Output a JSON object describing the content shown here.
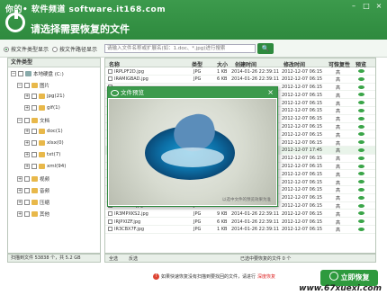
{
  "watermark_top": "你的• 软件频道 software.it168.com",
  "header": {
    "title": "请选择需要恢复的文件"
  },
  "window_buttons": [
    "–",
    "□",
    "×"
  ],
  "options": {
    "by_type": "按文件类型显示",
    "by_path": "按文件路径显示",
    "search_placeholder": "请输入文件名称或扩展名(如：1.doc、*.jpg)进行搜索",
    "search_button": "🔍"
  },
  "tree": {
    "header": "文件类型",
    "disk": "本地硬盘 (C:)",
    "items": [
      {
        "label": "图片"
      },
      {
        "label": "jpg(21)"
      },
      {
        "label": "gif(1)"
      },
      {
        "label": "文档"
      },
      {
        "label": "doc(1)"
      },
      {
        "label": "xlsx(0)"
      },
      {
        "label": "txt(7)"
      },
      {
        "label": "xml(94)"
      },
      {
        "label": "视频"
      },
      {
        "label": "音频"
      },
      {
        "label": "压缩"
      },
      {
        "label": "其他"
      }
    ]
  },
  "table": {
    "headers": [
      "名称",
      "类型",
      "大小",
      "创建时间",
      "修改时间",
      "可恢复性",
      "预览"
    ],
    "rows": [
      {
        "name": "IRPLPF2D.jpg",
        "type": "JPG",
        "size": "1 KB",
        "created": "2014-01-26 22:39:11",
        "modified": "2012-12-07 06:15",
        "rec": "高"
      },
      {
        "name": "IRAMIGBAD.jpg",
        "type": "JPG",
        "size": "6 KB",
        "created": "2014-01-26 22:39:11",
        "modified": "2012-12-07 06:15",
        "rec": "高"
      },
      {
        "name": "",
        "type": "",
        "size": "",
        "created": "",
        "modified": "2012-12-07 06:15",
        "rec": "高"
      },
      {
        "name": "",
        "type": "",
        "size": "",
        "created": "",
        "modified": "2012-12-07 06:15",
        "rec": "高"
      },
      {
        "name": "",
        "type": "",
        "size": "",
        "created": "",
        "modified": "2012-12-07 06:15",
        "rec": "高"
      },
      {
        "name": "",
        "type": "",
        "size": "",
        "created": "",
        "modified": "2012-12-07 06:15",
        "rec": "高"
      },
      {
        "name": "",
        "type": "",
        "size": "",
        "created": "",
        "modified": "2012-12-07 06:15",
        "rec": "高"
      },
      {
        "name": "",
        "type": "",
        "size": "",
        "created": "",
        "modified": "2012-12-07 06:15",
        "rec": "高"
      },
      {
        "name": "",
        "type": "",
        "size": "",
        "created": "",
        "modified": "2012-12-07 06:15",
        "rec": "高"
      },
      {
        "name": "",
        "type": "",
        "size": "",
        "created": "",
        "modified": "2012-12-07 06:15",
        "rec": "高"
      },
      {
        "name": "",
        "type": "",
        "size": "",
        "created": "",
        "modified": "2012-12-07 17:45",
        "rec": "高"
      },
      {
        "name": "",
        "type": "",
        "size": "",
        "created": "",
        "modified": "2012-12-07 06:15",
        "rec": "高"
      },
      {
        "name": "",
        "type": "",
        "size": "",
        "created": "",
        "modified": "2012-12-07 06:15",
        "rec": "高"
      },
      {
        "name": "",
        "type": "",
        "size": "",
        "created": "",
        "modified": "2012-12-07 06:15",
        "rec": "高"
      },
      {
        "name": "",
        "type": "",
        "size": "",
        "created": "",
        "modified": "2012-12-07 06:15",
        "rec": "高"
      },
      {
        "name": "",
        "type": "",
        "size": "",
        "created": "",
        "modified": "2012-12-07 06:15",
        "rec": "高"
      },
      {
        "name": "",
        "type": "",
        "size": "",
        "created": "",
        "modified": "2012-12-07 06:15",
        "rec": "高"
      },
      {
        "name": "IRLFAYAC.jpg",
        "type": "JPG",
        "size": "14 KB",
        "created": "2014-01-26 22:39:11",
        "modified": "2012-12-07 06:15",
        "rec": "高"
      },
      {
        "name": "IR3MPXKS2.jpg",
        "type": "JPG",
        "size": "9 KB",
        "created": "2014-01-26 22:39:11",
        "modified": "2012-12-07 06:15",
        "rec": "高"
      },
      {
        "name": "IRJPXIZF.jpg",
        "type": "JPG",
        "size": "6 KB",
        "created": "2014-01-26 22:39:11",
        "modified": "2012-12-07 06:15",
        "rec": "高"
      },
      {
        "name": "IR3CBX7F.jpg",
        "type": "JPG",
        "size": "1 KB",
        "created": "2014-01-26 22:39:11",
        "modified": "2012-12-07 06:15",
        "rec": "高"
      }
    ]
  },
  "preview": {
    "title": "文件预览",
    "close": "×",
    "caption": "以选中文件的预览效果为准"
  },
  "status": {
    "left": "扫描到文件 53838 个，共 5.2 GB",
    "select_all": "全选",
    "deselect": "反选",
    "selected": "已选中要恢复的文件 0 个"
  },
  "bottom": {
    "warn_prefix": "如果快速恢复没有扫描到要找回的文件，请进行",
    "warn_link": "深度恢复",
    "recover_button": "立即恢复"
  },
  "watermark_bottom": "www.67xuexi.com",
  "colors": {
    "accent": "#2e8a3e"
  }
}
